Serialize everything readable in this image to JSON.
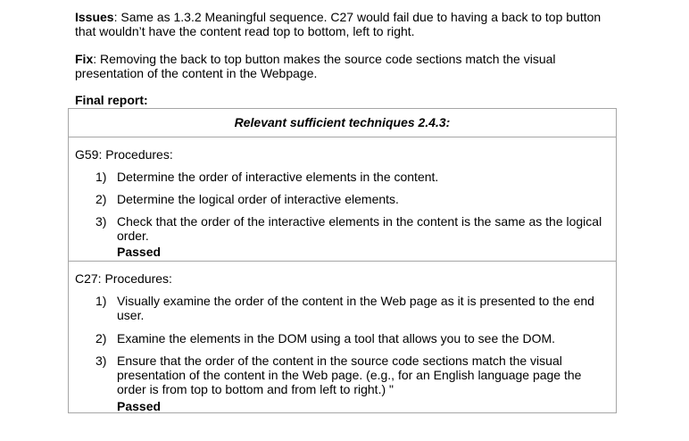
{
  "issues": {
    "label": "Issues",
    "text": ": Same as 1.3.2 Meaningful sequence. C27 would fail due to having a back to top button that wouldn’t have the content read top to bottom, left to right."
  },
  "fix": {
    "label": "Fix",
    "text": ": Removing the back to top button makes the source code sections match the visual presentation of the content in the Webpage."
  },
  "final_report_label": "Final report:",
  "table": {
    "header": "Relevant sufficient techniques 2.4.3:",
    "sections": [
      {
        "title": "G59: Procedures:",
        "steps": [
          {
            "num": "1)",
            "text": " Determine the order of interactive elements in the content."
          },
          {
            "num": "2)",
            "text": "Determine the logical order of interactive elements."
          },
          {
            "num": "3)",
            "text": "Check that the order of the interactive elements in the content is the same as the logical order."
          }
        ],
        "result": "Passed"
      },
      {
        "title": "C27: Procedures:",
        "steps": [
          {
            "num": "1)",
            "text": "Visually examine the order of the content in the Web page as it is presented to the end user."
          },
          {
            "num": "2)",
            "text": "Examine the elements in the DOM using a tool that allows you to see the DOM."
          },
          {
            "num": "3)",
            "text": "Ensure that the order of the content in the source code sections match the visual presentation of the content in the Web page. (e.g., for an English language page the order is from top to bottom and from left to right.) \""
          }
        ],
        "result": "Passed"
      }
    ]
  }
}
